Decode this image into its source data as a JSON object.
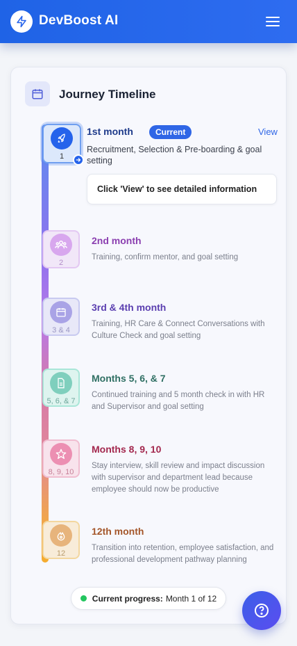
{
  "app": {
    "title": "DevBoost AI",
    "logo_icon": "lightning-icon",
    "menu_icon": "hamburger-icon"
  },
  "timeline": {
    "title": "Journey Timeline",
    "header_icon": "calendar-icon",
    "steps": [
      {
        "title": "1st month",
        "badge": "Current",
        "view": "View",
        "number": "1",
        "description": "Recruitment, Selection & Pre-boarding & goal setting",
        "info": "Click 'View' to see detailed information",
        "icon": "rocket-icon",
        "color": "#2563eb"
      },
      {
        "title": "2nd month",
        "number": "2",
        "description": "Training, confirm mentor, and goal setting",
        "icon": "users-icon",
        "color": "#8b3fb0"
      },
      {
        "title": "3rd & 4th month",
        "number": "3 & 4",
        "description": "Training, HR Care & Connect Conversations with Culture Check and goal setting",
        "icon": "calendar-icon",
        "color": "#5b3fb0"
      },
      {
        "title": "Months 5, 6, & 7",
        "number": "5, 6, & 7",
        "description": "Continued training and 5 month check in with HR and Supervisor and goal setting",
        "icon": "document-icon",
        "color": "#2f6f63"
      },
      {
        "title": "Months 8, 9, 10",
        "number": "8, 9, 10",
        "description": "Stay interview, skill review and impact discussion with supervisor and department lead because employee should now be productive",
        "icon": "star-icon",
        "color": "#a3284e"
      },
      {
        "title": "12th month",
        "number": "12",
        "description": "Transition into retention, employee satisfaction, and professional development pathway planning",
        "icon": "flame-icon",
        "color": "#a4562a"
      }
    ]
  },
  "progress": {
    "label": "Current progress:",
    "value": "Month 1 of 12"
  },
  "help": {
    "icon": "help-icon"
  }
}
